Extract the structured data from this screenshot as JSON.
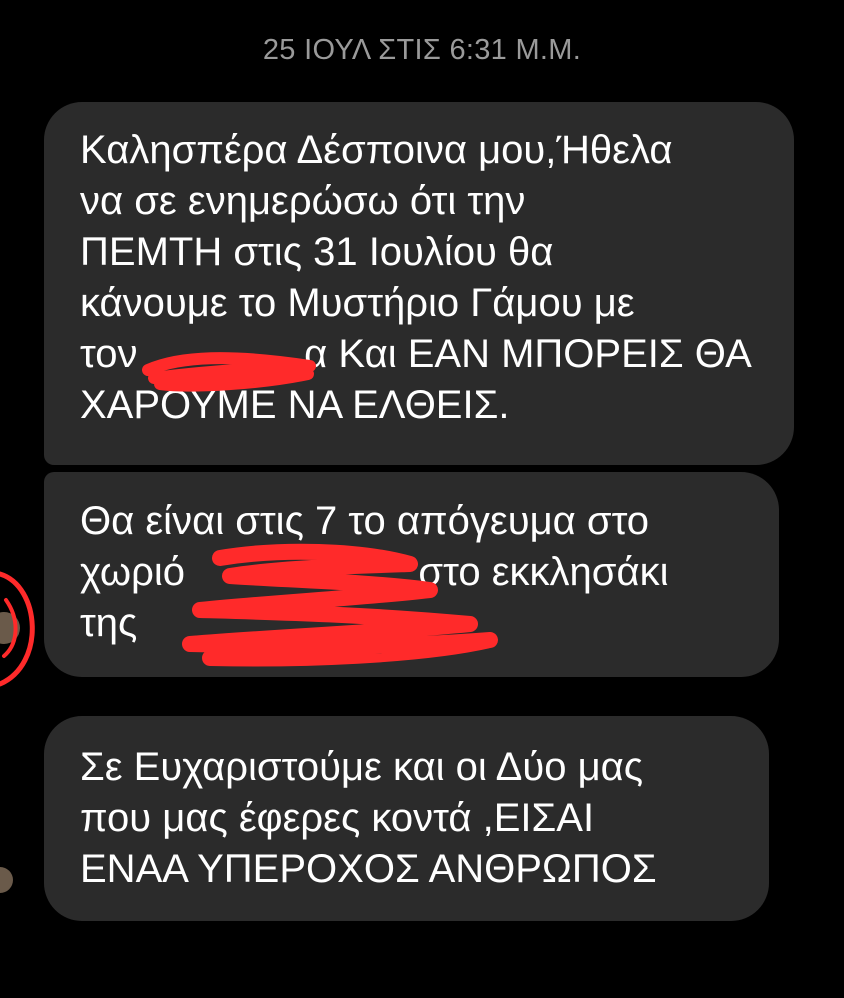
{
  "conversation": {
    "timestamp": "25 ΙΟΥΛ ΣΤΙΣ 6:31 Μ.Μ.",
    "messages": [
      {
        "lines": [
          "Καλησπέρα Δέσποινα μου,Ήθελα",
          "να σε ενημερώσω ότι την",
          "ΠΕΜΤΗ στις 31 Ιουλίου  θα",
          "κάνουμε το Μυστήριο Γάμου με",
          "τον               α Και ΕΑΝ ΜΠΟΡΕΙΣ ΘΑ",
          "ΧΑΡΟΥΜΕ ΝΑ ΕΛΘΕΙΣ."
        ]
      },
      {
        "lines": [
          "Θα είναι στις 7 το απόγευμα  στο",
          "χωριό                     στο εκκλησάκι",
          "της"
        ]
      },
      {
        "lines": [
          "Σε Ευχαριστούμε και οι Δύο μας",
          "που μας έφερες κοντά ,ΕΙΣΑΙ",
          "ΕΝΑΑ ΥΠΕΡΟΧΟΣ ΑΝΘΡΩΠΟΣ"
        ]
      }
    ]
  },
  "colors": {
    "background": "#000000",
    "bubble": "#2b2b2b",
    "text": "#ffffff",
    "timestamp": "#9a9a9a",
    "redaction": "#ff2a2a"
  }
}
